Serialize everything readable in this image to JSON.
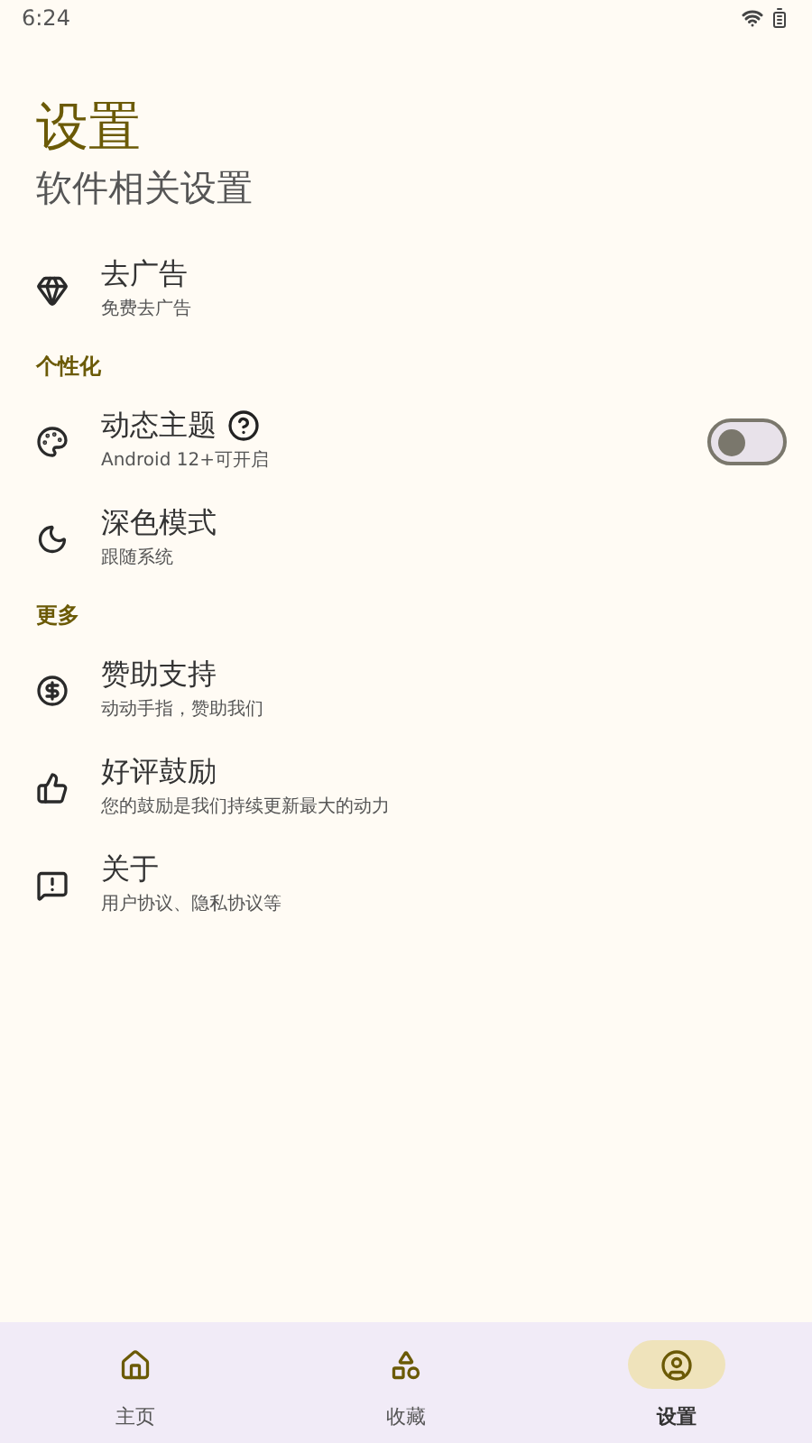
{
  "status_bar": {
    "time": "6:24"
  },
  "header": {
    "title": "设置",
    "subtitle": "软件相关设置"
  },
  "sections": [
    {
      "items": [
        {
          "kind": "plain",
          "title": "去广告",
          "subtitle": "免费去广告"
        }
      ]
    },
    {
      "header": "个性化",
      "items": [
        {
          "kind": "switch",
          "title": "动态主题",
          "subtitle": "Android 12+可开启",
          "on": false
        },
        {
          "kind": "plain",
          "title": "深色模式",
          "subtitle": "跟随系统"
        }
      ]
    },
    {
      "header": "更多",
      "items": [
        {
          "kind": "plain",
          "title": "赞助支持",
          "subtitle": "动动手指，赞助我们"
        },
        {
          "kind": "plain",
          "title": "好评鼓励",
          "subtitle": "您的鼓励是我们持续更新最大的动力"
        },
        {
          "kind": "plain",
          "title": "关于",
          "subtitle": "用户协议、隐私协议等"
        }
      ]
    }
  ],
  "bottom_nav": [
    {
      "label": "主页",
      "selected": false
    },
    {
      "label": "收藏",
      "selected": false
    },
    {
      "label": "设置",
      "selected": true
    }
  ]
}
